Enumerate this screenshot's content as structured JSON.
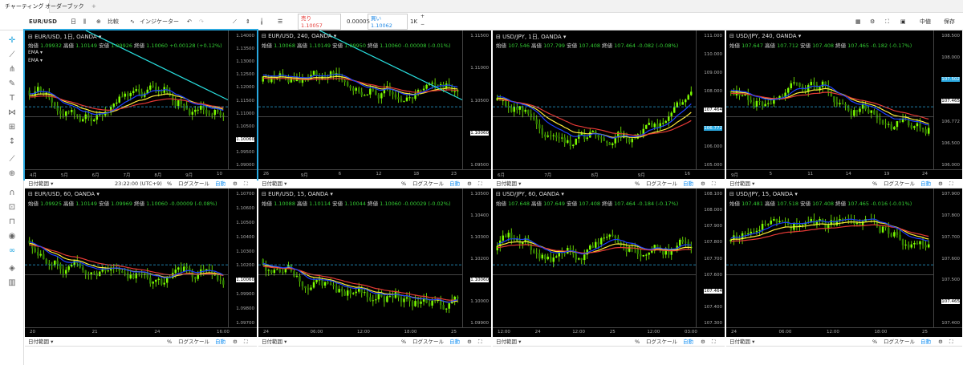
{
  "tabs": [
    "チャーティング",
    "オーダーブック"
  ],
  "toolbar": {
    "symbol": "EUR/USD",
    "compare": "比較",
    "indicators": "インジケーター",
    "sell_label": "売り",
    "sell_price": "1.10057",
    "spread": "0.00005",
    "buy_label": "買い",
    "buy_price": "1.10062",
    "qty": "1K",
    "midpoint": "中値",
    "save": "保存"
  },
  "bottom": {
    "range": "日付範囲",
    "pct": "%",
    "log": "ログスケール",
    "auto": "自動",
    "time": "23:22:00 (UTC+9)"
  },
  "ohlc_labels": {
    "o": "始値",
    "h": "高値",
    "l": "安値",
    "c": "終値"
  },
  "colors": {
    "sell": "#e53935",
    "buy": "#1e88e5",
    "up": "#4caf50",
    "accent": "#29a8e0"
  },
  "charts": [
    {
      "title": "EUR/USD, 1日, OANDA",
      "o": "1.09932",
      "h": "1.10149",
      "l": "1.09926",
      "c": "1.10060",
      "chg": "+0.00128 (+0.12%)",
      "emas": [
        "EMA",
        "EMA"
      ],
      "y": [
        "1.14000",
        "1.13500",
        "1.13000",
        "1.12500",
        "1.12000",
        "1.11500",
        "1.11000",
        "1.10500",
        "1.10060",
        "1.09500",
        "1.09000"
      ],
      "x": [
        "4月",
        "5月",
        "6月",
        "7月",
        "8月",
        "9月",
        "10"
      ],
      "price": "1.10060",
      "price2": ""
    },
    {
      "title": "EUR/USD, 240, OANDA",
      "o": "1.10068",
      "h": "1.10149",
      "l": "1.09950",
      "c": "1.10060",
      "chg": "-0.00008 (-0.01%)",
      "emas": [],
      "y": [
        "1.11500",
        "1.11000",
        "1.10500",
        "1.10060",
        "1.09500"
      ],
      "x": [
        "26",
        "9月",
        "6",
        "12",
        "18",
        "23"
      ],
      "price": "1.10060",
      "price2": ""
    },
    {
      "title": "USD/JPY, 1日, OANDA",
      "o": "107.546",
      "h": "107.799",
      "l": "107.408",
      "c": "107.464",
      "chg": "-0.082 (-0.08%)",
      "emas": [],
      "y": [
        "111.000",
        "110.000",
        "109.000",
        "108.000",
        "107.464",
        "106.772",
        "106.000",
        "105.000"
      ],
      "x": [
        "6月",
        "7月",
        "8月",
        "9月",
        "16"
      ],
      "price": "107.464",
      "price2": "106.772"
    },
    {
      "title": "USD/JPY, 240, OANDA",
      "o": "107.647",
      "h": "107.712",
      "l": "107.408",
      "c": "107.465",
      "chg": "-0.182 (-0.17%)",
      "emas": [],
      "y": [
        "108.500",
        "108.000",
        "107.502",
        "107.465",
        "106.772",
        "106.500",
        "106.000"
      ],
      "x": [
        "9月",
        "5",
        "11",
        "14",
        "19",
        "24"
      ],
      "price": "107.465",
      "price2": "107.502"
    },
    {
      "title": "EUR/USD, 60, OANDA",
      "o": "1.09925",
      "h": "1.10149",
      "l": "1.09969",
      "c": "1.10060",
      "chg": "-0.00009 (-0.08%)",
      "emas": [],
      "y": [
        "1.10700",
        "1.10600",
        "1.10500",
        "1.10400",
        "1.10300",
        "1.10200",
        "1.10060",
        "1.09900",
        "1.09800",
        "1.09700"
      ],
      "x": [
        "20",
        "21",
        "24",
        "16:00"
      ],
      "price": "1.10060",
      "price2": ""
    },
    {
      "title": "EUR/USD, 15, OANDA",
      "o": "1.10088",
      "h": "1.10114",
      "l": "1.10044",
      "c": "1.10060",
      "chg": "-0.00029 (-0.02%)",
      "emas": [],
      "y": [
        "1.10500",
        "1.10400",
        "1.10300",
        "1.10200",
        "1.10060",
        "1.10000",
        "1.09900"
      ],
      "x": [
        "24",
        "06:00",
        "12:00",
        "18:00",
        "25"
      ],
      "price": "1.10060",
      "price2": ""
    },
    {
      "title": "USD/JPY, 60, OANDA",
      "o": "107.648",
      "h": "107.649",
      "l": "107.408",
      "c": "107.464",
      "chg": "-0.184 (-0.17%)",
      "emas": [],
      "y": [
        "108.100",
        "108.000",
        "107.900",
        "107.800",
        "107.700",
        "107.600",
        "107.464",
        "107.400",
        "107.300"
      ],
      "x": [
        "12:00",
        "24",
        "12:00",
        "25",
        "12:00",
        "03:00"
      ],
      "price": "107.464",
      "price2": ""
    },
    {
      "title": "USD/JPY, 15, OANDA",
      "o": "107.481",
      "h": "107.518",
      "l": "107.408",
      "c": "107.465",
      "chg": "-0.016 (-0.01%)",
      "emas": [],
      "y": [
        "107.900",
        "107.800",
        "107.700",
        "107.600",
        "107.500",
        "107.465",
        "107.400"
      ],
      "x": [
        "24",
        "06:00",
        "12:00",
        "18:00",
        "25"
      ],
      "price": "107.465",
      "price2": ""
    }
  ]
}
